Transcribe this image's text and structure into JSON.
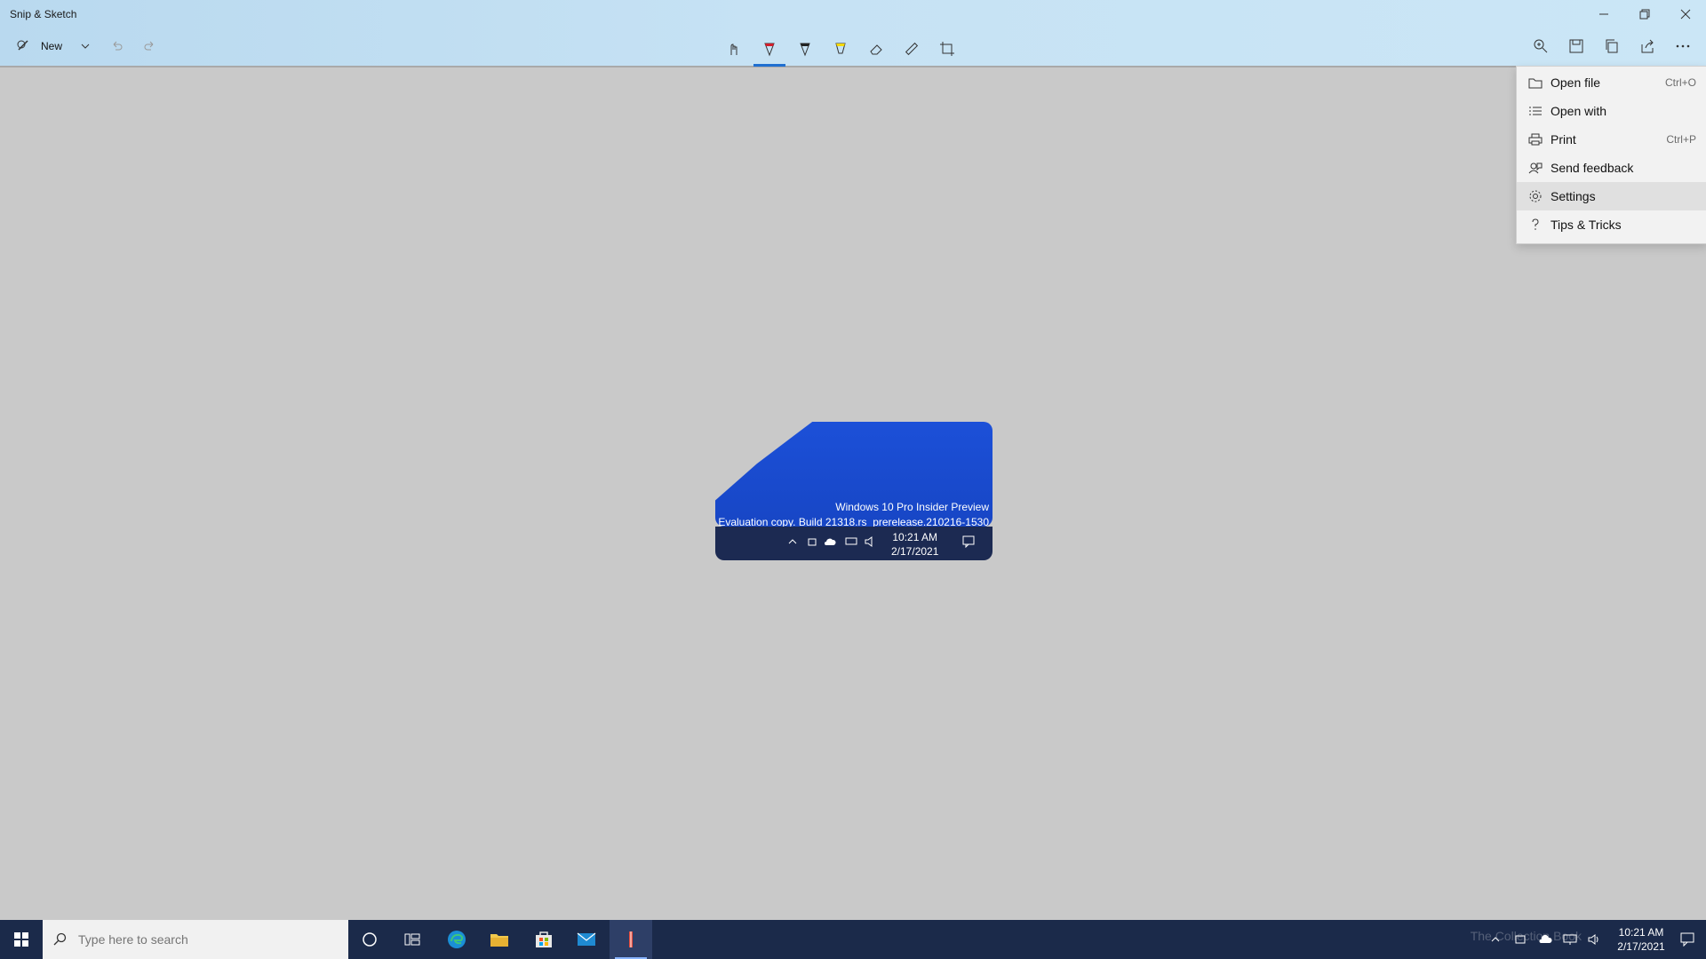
{
  "app": {
    "title": "Snip & Sketch"
  },
  "toolbar": {
    "new_label": "New"
  },
  "menu": {
    "items": [
      {
        "label": "Open file",
        "shortcut": "Ctrl+O"
      },
      {
        "label": "Open with",
        "shortcut": ""
      },
      {
        "label": "Print",
        "shortcut": "Ctrl+P"
      },
      {
        "label": "Send feedback",
        "shortcut": ""
      },
      {
        "label": "Settings",
        "shortcut": ""
      },
      {
        "label": "Tips & Tricks",
        "shortcut": ""
      }
    ]
  },
  "snip": {
    "watermark_line1": "Windows 10 Pro Insider Preview",
    "watermark_line2": "Evaluation copy. Build 21318.rs_prerelease.210216-1530",
    "time": "10:21 AM",
    "date": "2/17/2021"
  },
  "taskbar": {
    "search_placeholder": "Type here to search",
    "time": "10:21 AM",
    "date": "2/17/2021",
    "watermark": "The Collection Book"
  },
  "colors": {
    "accent": "#1f6fd0",
    "taskbar": "#1b2a4a"
  }
}
